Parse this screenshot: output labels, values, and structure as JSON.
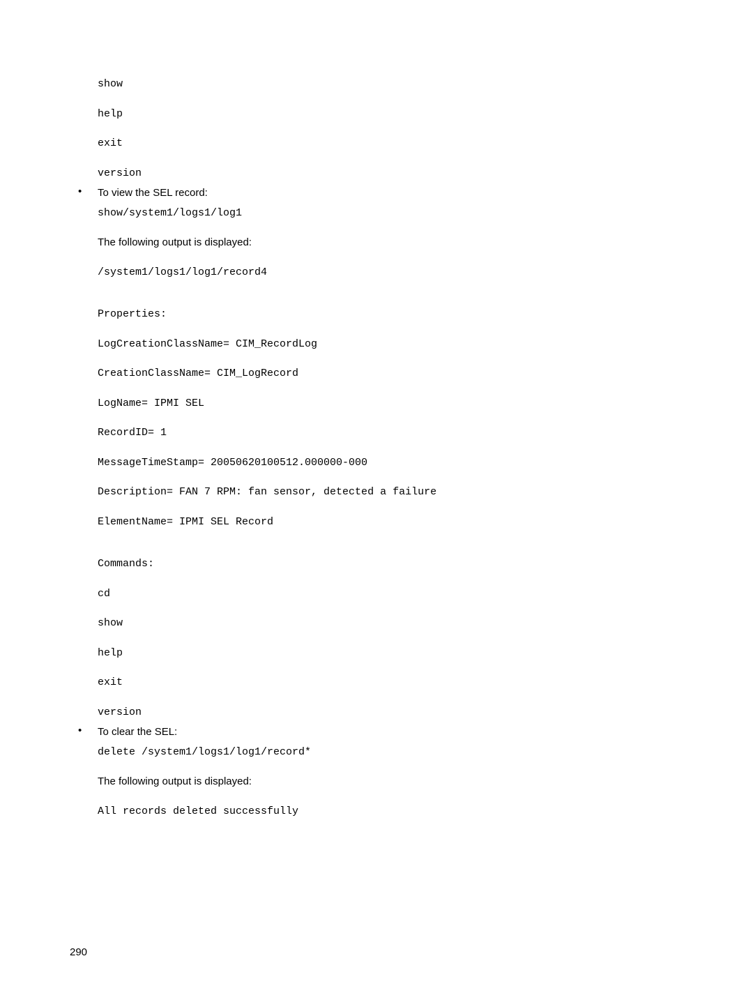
{
  "block1": {
    "cmd1": "show",
    "cmd2": "help",
    "cmd3": "exit",
    "cmd4": "version"
  },
  "section_view": {
    "intro": "To view the SEL record:",
    "cmd": "show/system1/logs1/log1",
    "output_label": "The following output is displayed:",
    "path": "/system1/logs1/log1/record4",
    "props_label": "Properties:",
    "p1": "LogCreationClassName= CIM_RecordLog",
    "p2": "CreationClassName= CIM_LogRecord",
    "p3": "LogName= IPMI SEL",
    "p4": "RecordID= 1",
    "p5": "MessageTimeStamp= 20050620100512.000000-000",
    "p6": "Description= FAN 7 RPM: fan sensor, detected a failure",
    "p7": "ElementName= IPMI SEL Record",
    "cmds_label": "Commands:",
    "c1": "cd",
    "c2": "show",
    "c3": "help",
    "c4": "exit",
    "c5": "version"
  },
  "section_clear": {
    "intro": "To clear the SEL:",
    "cmd": "delete /system1/logs1/log1/record*",
    "output_label": "The following output is displayed:",
    "result": "All records deleted successfully"
  },
  "page_number": "290"
}
